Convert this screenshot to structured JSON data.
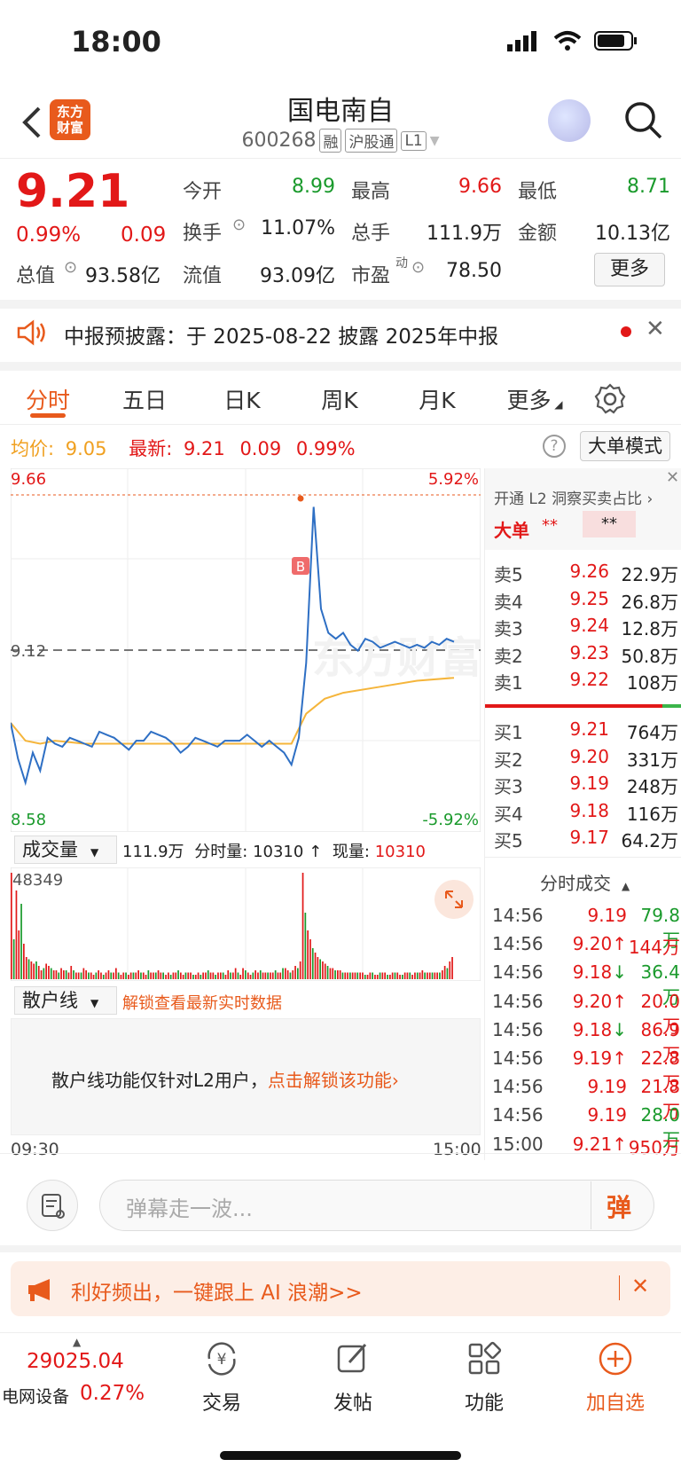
{
  "status": {
    "time": "18:00"
  },
  "header": {
    "logo_text_1": "东方",
    "logo_text_2": "财富",
    "name": "国电南自",
    "code": "600268",
    "tags": [
      "融",
      "沪股通",
      "L1"
    ]
  },
  "quote": {
    "price": "9.21",
    "change_pct": "0.99%",
    "change": "0.09",
    "fields": [
      {
        "label": "今开",
        "value": "8.99",
        "color": "green"
      },
      {
        "label": "最高",
        "value": "9.66",
        "color": "red"
      },
      {
        "label": "最低",
        "value": "8.71",
        "color": "green"
      },
      {
        "label": "换手",
        "value": "11.07%",
        "color": "normal"
      },
      {
        "label": "总手",
        "value": "111.9万",
        "color": "normal"
      },
      {
        "label": "金额",
        "value": "10.13亿",
        "color": "normal"
      },
      {
        "label": "总值",
        "value": "93.58亿",
        "color": "normal"
      },
      {
        "label": "流值",
        "value": "93.09亿",
        "color": "normal"
      },
      {
        "label": "市盈",
        "value": "78.50",
        "color": "normal"
      }
    ],
    "pe_sup": "动",
    "more_label": "更多"
  },
  "notice": {
    "text": "中报预披露：于 2025-08-22 披露 2025年中报"
  },
  "tabs": [
    "分时",
    "五日",
    "日K",
    "周K",
    "月K",
    "更多"
  ],
  "avgrow": {
    "avg_label": "均价:",
    "avg_value": "9.05",
    "latest_label": "最新:",
    "latest_value": "9.21",
    "change": "0.09",
    "pct": "0.99%",
    "help": "?",
    "mode_label": "大单模式"
  },
  "chart_data": {
    "type": "line",
    "y_high_label": "9.66",
    "y_low_label": "8.58",
    "pct_high_label": "5.92%",
    "pct_low_label": "-5.92%",
    "prev_close_label": "9.12",
    "marker_label": "B",
    "time_start": "09:30",
    "time_end": "15:00",
    "ylim": [
      8.58,
      9.66
    ],
    "series": [
      {
        "x": [
          0,
          4,
          8,
          12,
          16,
          20,
          24,
          28,
          32,
          36,
          40,
          44,
          48,
          52,
          56,
          60,
          64,
          68,
          72,
          76,
          80,
          84,
          88,
          92,
          96,
          100,
          104,
          108,
          112,
          116,
          120,
          124,
          128,
          132,
          136,
          140,
          144,
          148,
          152,
          156,
          160,
          164,
          168,
          172,
          176,
          180,
          184,
          188,
          192,
          196,
          200,
          204,
          208,
          212,
          216,
          220,
          224,
          228,
          232,
          236,
          240
        ],
        "values": [
          8.9,
          8.78,
          8.7,
          8.8,
          8.74,
          8.85,
          8.83,
          8.82,
          8.85,
          8.84,
          8.83,
          8.82,
          8.87,
          8.86,
          8.85,
          8.83,
          8.81,
          8.84,
          8.84,
          8.87,
          8.86,
          8.85,
          8.83,
          8.8,
          8.82,
          8.85,
          8.84,
          8.83,
          8.82,
          8.84,
          8.84,
          8.84,
          8.86,
          8.84,
          8.82,
          8.84,
          8.82,
          8.8,
          8.76,
          8.85,
          9.1,
          9.62,
          9.28,
          9.2,
          9.18,
          9.2,
          9.16,
          9.14,
          9.18,
          9.17,
          9.15,
          9.16,
          9.17,
          9.16,
          9.15,
          9.16,
          9.15,
          9.17,
          9.16,
          9.18,
          9.17
        ]
      },
      {
        "x": [
          0,
          8,
          16,
          24,
          40,
          60,
          80,
          100,
          120,
          140,
          152,
          160,
          170,
          180,
          200,
          220,
          240
        ],
        "values": [
          8.9,
          8.84,
          8.83,
          8.84,
          8.83,
          8.83,
          8.83,
          8.83,
          8.83,
          8.83,
          8.83,
          8.93,
          8.98,
          9.0,
          9.02,
          9.04,
          9.05
        ]
      }
    ]
  },
  "volume": {
    "selector": "成交量",
    "total": "111.9万",
    "tick_label": "分时量:",
    "tick_value": "10310",
    "now_label": "现量:",
    "now_value": "10310",
    "max_label": "48349",
    "bars": [
      48,
      18,
      40,
      22,
      34,
      16,
      10,
      9,
      8,
      7,
      8,
      6,
      4,
      5,
      7,
      6,
      5,
      4,
      4,
      3,
      5,
      4,
      4,
      3,
      6,
      4,
      3,
      3,
      3,
      5,
      4,
      3,
      3,
      2,
      3,
      4,
      3,
      2,
      3,
      4,
      3,
      3,
      5,
      3,
      2,
      3,
      3,
      2,
      3,
      3,
      3,
      4,
      3,
      3,
      2,
      4,
      3,
      3,
      3,
      4,
      3,
      3,
      2,
      3,
      2,
      3,
      3,
      4,
      3,
      2,
      3,
      3,
      3,
      2,
      2,
      3,
      2,
      3,
      3,
      4,
      3,
      3,
      2,
      3,
      3,
      3,
      2,
      4,
      3,
      3,
      5,
      3,
      2,
      5,
      4,
      3,
      2,
      3,
      4,
      3,
      4,
      3,
      3,
      3,
      3,
      3,
      4,
      3,
      3,
      5,
      5,
      4,
      3,
      4,
      6,
      5,
      8,
      48,
      30,
      22,
      18,
      14,
      12,
      10,
      9,
      8,
      7,
      6,
      5,
      5,
      4,
      4,
      4,
      3,
      3,
      3,
      3,
      3,
      3,
      3,
      3,
      3,
      2,
      2,
      3,
      3,
      2,
      2,
      3,
      3,
      3,
      2,
      2,
      3,
      3,
      3,
      2,
      2,
      3,
      3,
      3,
      2,
      3,
      3,
      3,
      4,
      3,
      3,
      3,
      3,
      3,
      3,
      3,
      4,
      6,
      5,
      8,
      10
    ]
  },
  "retail_line": {
    "selector": "散户线",
    "unlock_tip": "解锁查看最新实时数据",
    "msg": "散户线功能仅针对L2用户，",
    "link": "点击解锁该功能"
  },
  "orderbook": {
    "l2_tip": "开通 L2 洞察买卖占比",
    "big_label": "大单",
    "masked": "**",
    "sells": [
      {
        "label": "卖5",
        "price": "9.26",
        "vol": "22.9万"
      },
      {
        "label": "卖4",
        "price": "9.25",
        "vol": "26.8万"
      },
      {
        "label": "卖3",
        "price": "9.24",
        "vol": "12.8万"
      },
      {
        "label": "卖2",
        "price": "9.23",
        "vol": "50.8万"
      },
      {
        "label": "卖1",
        "price": "9.22",
        "vol": "108万"
      }
    ],
    "buys": [
      {
        "label": "买1",
        "price": "9.21",
        "vol": "764万"
      },
      {
        "label": "买2",
        "price": "9.20",
        "vol": "331万"
      },
      {
        "label": "买3",
        "price": "9.19",
        "vol": "248万"
      },
      {
        "label": "买4",
        "price": "9.18",
        "vol": "116万"
      },
      {
        "label": "买5",
        "price": "9.17",
        "vol": "64.2万"
      }
    ],
    "trades_title": "分时成交",
    "trades": [
      {
        "time": "14:56",
        "price": "9.19",
        "arrow": "",
        "vol": "79.8万",
        "dir": "down"
      },
      {
        "time": "14:56",
        "price": "9.20",
        "arrow": "↑",
        "vol": "144万",
        "dir": "up"
      },
      {
        "time": "14:56",
        "price": "9.18",
        "arrow": "↓",
        "vol": "36.4万",
        "dir": "down"
      },
      {
        "time": "14:56",
        "price": "9.20",
        "arrow": "↑",
        "vol": "20.0万",
        "dir": "up"
      },
      {
        "time": "14:56",
        "price": "9.18",
        "arrow": "↓",
        "vol": "86.9万",
        "dir": "up"
      },
      {
        "time": "14:56",
        "price": "9.19",
        "arrow": "↑",
        "vol": "22.8万",
        "dir": "up"
      },
      {
        "time": "14:56",
        "price": "9.19",
        "arrow": "",
        "vol": "21.8万",
        "dir": "up"
      },
      {
        "time": "14:56",
        "price": "9.19",
        "arrow": "",
        "vol": "28.0万",
        "dir": "down"
      },
      {
        "time": "15:00",
        "price": "9.21",
        "arrow": "↑",
        "vol": "950万",
        "dir": "up"
      }
    ]
  },
  "comment": {
    "placeholder": "弹幕走一波...",
    "danmu_label": "弹"
  },
  "ad": {
    "text": "利好频出，一键跟上 AI 浪潮>>"
  },
  "bottom": {
    "index_value": "29025.04",
    "index_name": "电网设备",
    "index_pct": "0.27%",
    "items": [
      "交易",
      "发帖",
      "功能",
      "加自选"
    ]
  },
  "colors": {
    "red": "#e21818",
    "green": "#1a9a2c",
    "orange": "#e85a1c",
    "avg_line": "#f5b53b",
    "price_line": "#2e6fc4"
  }
}
